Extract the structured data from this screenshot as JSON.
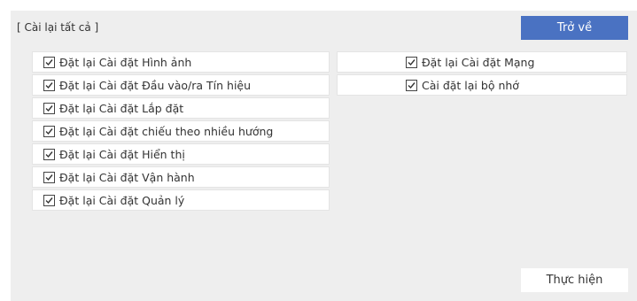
{
  "title": "[ Cài lại tất cả ]",
  "back_button": "Trở về",
  "execute_button": "Thực hiện",
  "left_items": [
    {
      "label": "Đặt lại Cài đặt Hình ảnh",
      "checked": true
    },
    {
      "label": "Đặt lại Cài đặt Đầu vào/ra Tín hiệu",
      "checked": true
    },
    {
      "label": "Đặt lại Cài đặt Lắp đặt",
      "checked": true
    },
    {
      "label": "Đặt lại Cài đặt chiếu theo nhiều hướng",
      "checked": true
    },
    {
      "label": "Đặt lại Cài đặt Hiển thị",
      "checked": true
    },
    {
      "label": "Đặt lại Cài đặt Vận hành",
      "checked": true
    },
    {
      "label": "Đặt lại Cài đặt Quản lý",
      "checked": true
    }
  ],
  "right_items": [
    {
      "label": "Đặt lại Cài đặt Mạng",
      "checked": true
    },
    {
      "label": "Cài đặt lại bộ nhớ",
      "checked": true
    }
  ],
  "colors": {
    "accent": "#4a72c2",
    "panel": "#eeeeee"
  }
}
